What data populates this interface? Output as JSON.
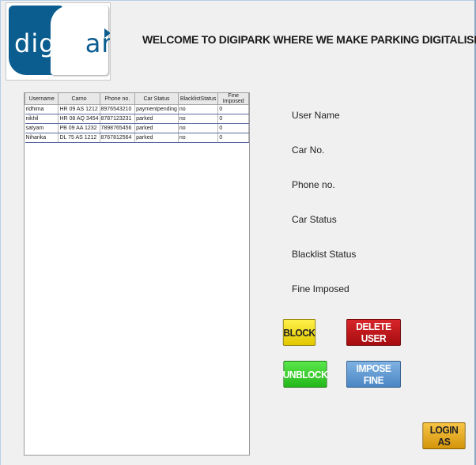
{
  "header": {
    "logo_text_digi": "digi",
    "logo_text_p": "P",
    "logo_text_ark": "ark",
    "welcome": "WELCOME TO DIGIPARK WHERE WE MAKE PARKING DIGITALISE"
  },
  "table": {
    "columns": [
      "Username",
      "Carno",
      "Phone no.",
      "Car Status",
      "BlacklistStatus",
      "Fine Imposed"
    ],
    "rows": [
      [
        "ridhima",
        "HR 09 AS 1212",
        "8976543210",
        "paymentpending",
        "no",
        "0"
      ],
      [
        "nikhil",
        "HR 08 AQ 3454",
        "8787123231",
        "parked",
        "no",
        "0"
      ],
      [
        "satyam",
        "PB 09 AA 1232",
        "7898765456",
        "parked",
        "no",
        "0"
      ],
      [
        "Niharika",
        "DL 75 AS 1212",
        "8767812564",
        "parked",
        "no",
        "0"
      ]
    ]
  },
  "details": {
    "user_name": "User Name",
    "car_no": "Car No.",
    "phone_no": "Phone no.",
    "car_status": "Car Status",
    "blacklist_status": "Blacklist Status",
    "fine_imposed": "Fine Imposed"
  },
  "actions": {
    "block": "BLOCK",
    "delete_user": "DELETE USER",
    "unblock": "UNBLOCK",
    "impose_fine": "IMPOSE FINE",
    "login_as": "LOGIN AS"
  },
  "colors": {
    "block": "#e2c800",
    "delete": "#b5141a",
    "unblock": "#33c627",
    "impose": "#5b93cf",
    "login": "#e5a81c",
    "logo_blue": "#0b5d8f"
  }
}
